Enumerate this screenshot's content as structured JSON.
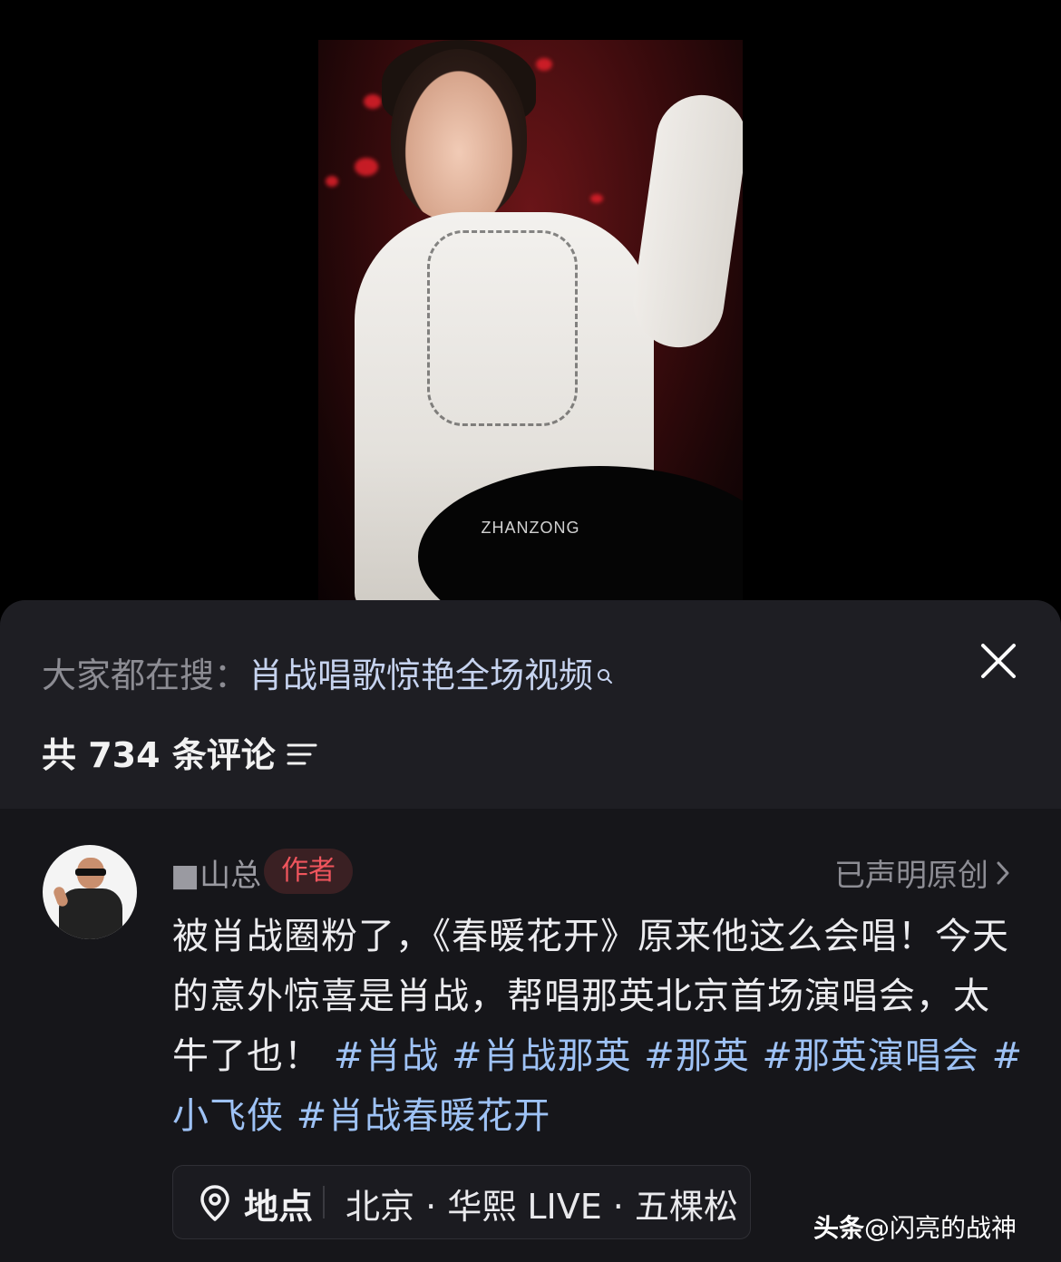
{
  "video": {
    "watermark": "ZHANZONG"
  },
  "sheet": {
    "search_prefix": "大家都在搜：",
    "search_query": "肖战唱歌惊艳全场视频",
    "comment_count_label": "共 734 条评论"
  },
  "comment": {
    "username": "■山总",
    "author_badge": "作者",
    "original_label": "已声明原创",
    "text_plain": "被肖战圈粉了，《春暖花开》原来他这么会唱！今天的意外惊喜是肖战，帮唱那英北京首场演唱会，太牛了也！",
    "hashtags": [
      "#肖战",
      "#肖战那英",
      "#那英",
      "#那英演唱会",
      "#小飞侠",
      "#肖战春暖花开"
    ],
    "location_label": "地点",
    "location_name": "北京 · 华熙 LIVE · 五棵松"
  },
  "site_watermark": {
    "brand": "头条",
    "handle": "@闪亮的战神"
  },
  "icons": {
    "search": "search-icon",
    "close": "close-icon",
    "sort": "sort-icon",
    "chevron": "chevron-right-icon",
    "location": "location-pin-icon"
  },
  "colors": {
    "sheet_bg": "#16161a",
    "header_bg": "#1e1e23",
    "hashtag": "#9ec2f5",
    "author_badge_text": "#f0555d",
    "author_badge_bg": "#3a2023"
  }
}
